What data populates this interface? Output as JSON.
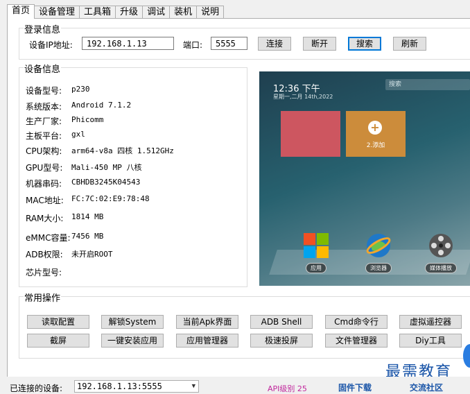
{
  "tabs": [
    "首页",
    "设备管理",
    "工具箱",
    "升级",
    "调试",
    "装机",
    "说明"
  ],
  "login": {
    "title": "登录信息",
    "ip_label": "设备IP地址:",
    "ip_value": "192.168.1.13",
    "port_label": "端口:",
    "port_value": "5555",
    "connect": "连接",
    "disconnect": "断开",
    "search": "搜索",
    "refresh": "刷新"
  },
  "device": {
    "title": "设备信息",
    "rows": [
      {
        "k": "设备型号:",
        "v": "p230"
      },
      {
        "k": "系统版本:",
        "v": "Android 7.1.2"
      },
      {
        "k": "生产厂家:",
        "v": "Phicomm"
      },
      {
        "k": "主板平台:",
        "v": "gxl"
      },
      {
        "k": "CPU架构:",
        "v": "arm64-v8a 四核 1.512GHz"
      },
      {
        "k": "GPU型号:",
        "v": "Mali-450 MP 八核"
      },
      {
        "k": "机器串码:",
        "v": "CBHDB3245K04543"
      },
      {
        "k": "MAC地址:",
        "v": "FC:7C:02:E9:78:48"
      },
      {
        "k": "RAM大小:",
        "v": "1814 MB"
      },
      {
        "k": "eMMC容量:",
        "v": "7456 MB"
      },
      {
        "k": "ADB权限:",
        "v": "未开启ROOT"
      },
      {
        "k": "芯片型号:",
        "v": ""
      }
    ]
  },
  "screen": {
    "time": "12:36 下午",
    "date": "星期一,二月 14th,2022",
    "search": "搜索",
    "tile_add": "2.添加",
    "apps": [
      "应用",
      "浏览器",
      "媒体播放"
    ]
  },
  "ops": {
    "title": "常用操作",
    "row1": [
      "读取配置",
      "解锁System",
      "当前Apk界面",
      "ADB Shell",
      "Cmd命令行",
      "虚拟遥控器"
    ],
    "row2": [
      "截屏",
      "一键安装应用",
      "应用管理器",
      "极速投屏",
      "文件管理器",
      "Diy工具"
    ]
  },
  "status": {
    "connected_label": "已连接的设备:",
    "connected_value": "192.168.1.13:5555",
    "api": "API级别 25",
    "firmware": "固件下载",
    "community": "交流社区",
    "watermark": "最需教育"
  }
}
